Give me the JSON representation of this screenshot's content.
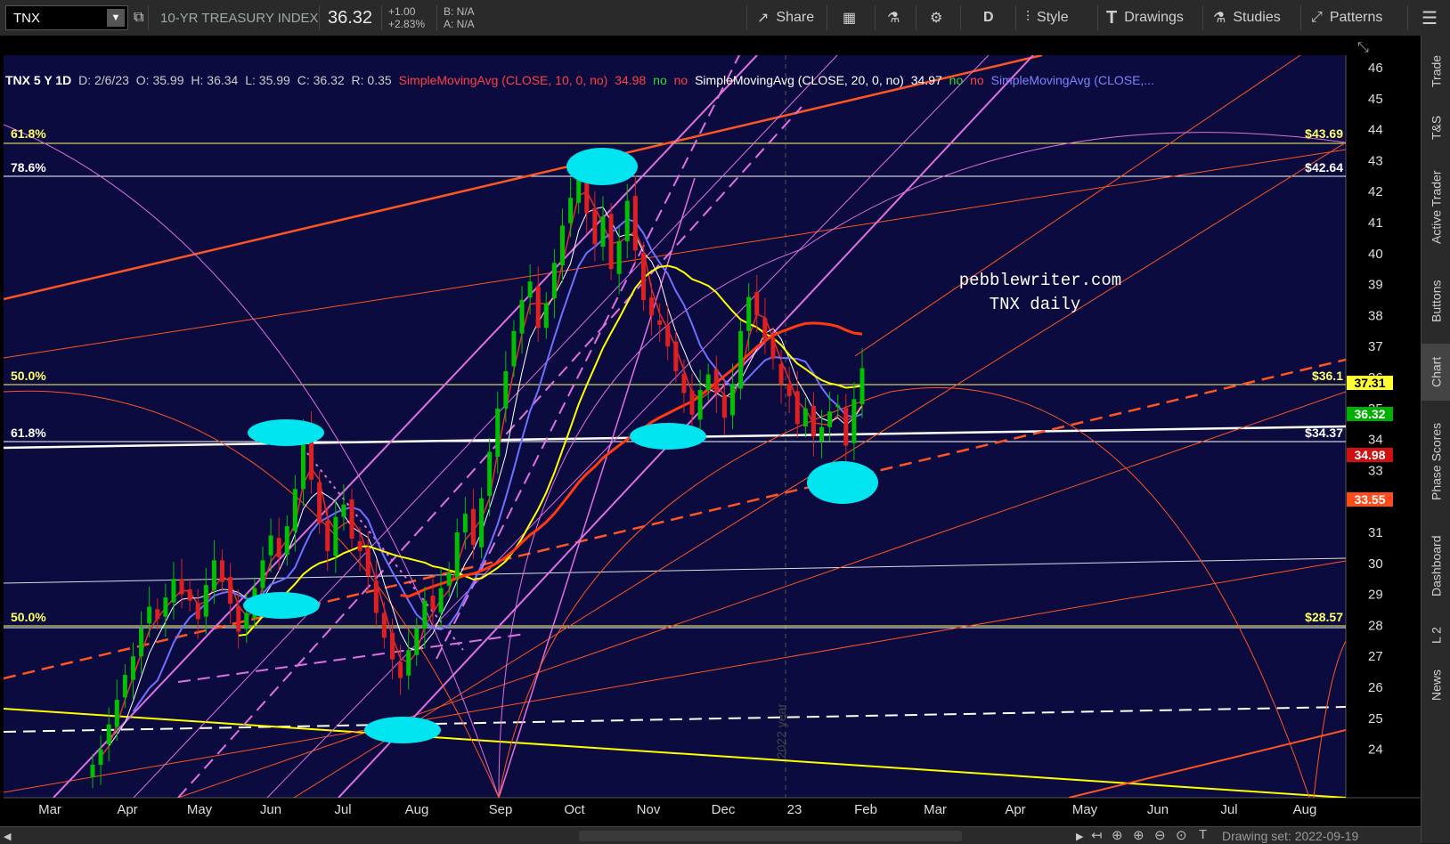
{
  "toolbar": {
    "symbol": "TNX",
    "index_name": "10-YR TREASURY INDEX",
    "last": "36.32",
    "change_abs": "+1.00",
    "change_pct": "+2.83%",
    "bid": "B: N/A",
    "ask": "A: N/A",
    "share": "Share",
    "period": "D",
    "style": "Style",
    "drawings": "Drawings",
    "studies": "Studies",
    "patterns": "Patterns"
  },
  "infobar": {
    "symbol_period": "TNX 5 Y 1D",
    "date": "D: 2/6/23",
    "open": "O: 35.99",
    "high": "H: 36.34",
    "low": "L: 35.99",
    "close": "C: 36.32",
    "range": "R: 0.35",
    "sma10": "SimpleMovingAvg (CLOSE, 10, 0, no)",
    "sma10_val": "34.98",
    "sma20": "SimpleMovingAvg (CLOSE, 20, 0, no)",
    "sma20_val": "34.97",
    "sma3": "SimpleMovingAvg (CLOSE,...",
    "no": "no"
  },
  "annotation": {
    "line1": "pebblewriter.com",
    "line2": "TNX daily"
  },
  "fib_labels": {
    "f618_top": "61.8%",
    "f786": "78.6%",
    "f500": "50.0%",
    "f618_mid": "61.8%",
    "f500_low": "50.0%",
    "p4369": "$43.69",
    "p4264": "$42.64",
    "p361": "$36.1",
    "p3437": "$34.37",
    "p2857": "$28.57"
  },
  "price_badges": {
    "sma_yellow": "37.31",
    "last": "36.32",
    "sma10": "34.98",
    "sma_long": "33.55"
  },
  "y_axis": [
    "46",
    "45",
    "44",
    "43",
    "42",
    "41",
    "40",
    "39",
    "38",
    "37",
    "36",
    "35",
    "34",
    "33",
    "32",
    "31",
    "30",
    "29",
    "28",
    "27",
    "26",
    "25",
    "24"
  ],
  "x_axis": [
    "Mar",
    "Apr",
    "May",
    "Jun",
    "Jul",
    "Aug",
    "Sep",
    "Oct",
    "Nov",
    "Dec",
    "23",
    "Feb",
    "Mar",
    "Apr",
    "May",
    "Jun",
    "Jul",
    "Aug"
  ],
  "watermark": "2022 year",
  "right_tabs": [
    "Trade",
    "T&S",
    "Active Trader",
    "Buttons",
    "Chart",
    "Phase Scores",
    "Dashboard",
    "L 2",
    "News"
  ],
  "status": {
    "drawing_set": "Drawing set: 2022-09-19"
  },
  "colors": {
    "bg": "#000000",
    "up": "#00c000",
    "down": "#e02020",
    "fib": "#ffff66",
    "magenta": "#e070e0",
    "orange": "#ff4a1a",
    "highlight": "#00e5f0"
  },
  "chart_data": {
    "type": "candlestick",
    "ylim": [
      23.3,
      46.4
    ],
    "closes": [
      23.5,
      24.0,
      24.8,
      25.6,
      26.4,
      27.0,
      27.9,
      28.6,
      28.2,
      28.9,
      29.5,
      29.0,
      28.8,
      28.2,
      29.3,
      30.1,
      29.4,
      28.7,
      27.8,
      28.4,
      29.2,
      30.1,
      30.9,
      30.2,
      31.2,
      32.4,
      34.1,
      32.7,
      31.3,
      30.4,
      31.5,
      31.9,
      30.8,
      30.4,
      29.6,
      28.4,
      27.6,
      26.9,
      26.3,
      27.2,
      27.9,
      28.8,
      28.5,
      29.2,
      29.7,
      31.0,
      31.6,
      30.6,
      32.1,
      33.6,
      35.0,
      36.2,
      37.5,
      38.5,
      39.1,
      37.6,
      38.4,
      39.7,
      40.9,
      41.8,
      42.9,
      41.3,
      40.3,
      41.2,
      39.5,
      40.4,
      41.7,
      40.1,
      38.5,
      38.0,
      37.7,
      37.0,
      36.2,
      35.5,
      34.8,
      35.6,
      36.1,
      35.5,
      34.7,
      35.8,
      37.5,
      38.6,
      38.0,
      37.2,
      36.6,
      35.8,
      35.4,
      34.5,
      35.0,
      34.1,
      34.4,
      34.9,
      35.1,
      33.8,
      35.3,
      36.3
    ]
  }
}
